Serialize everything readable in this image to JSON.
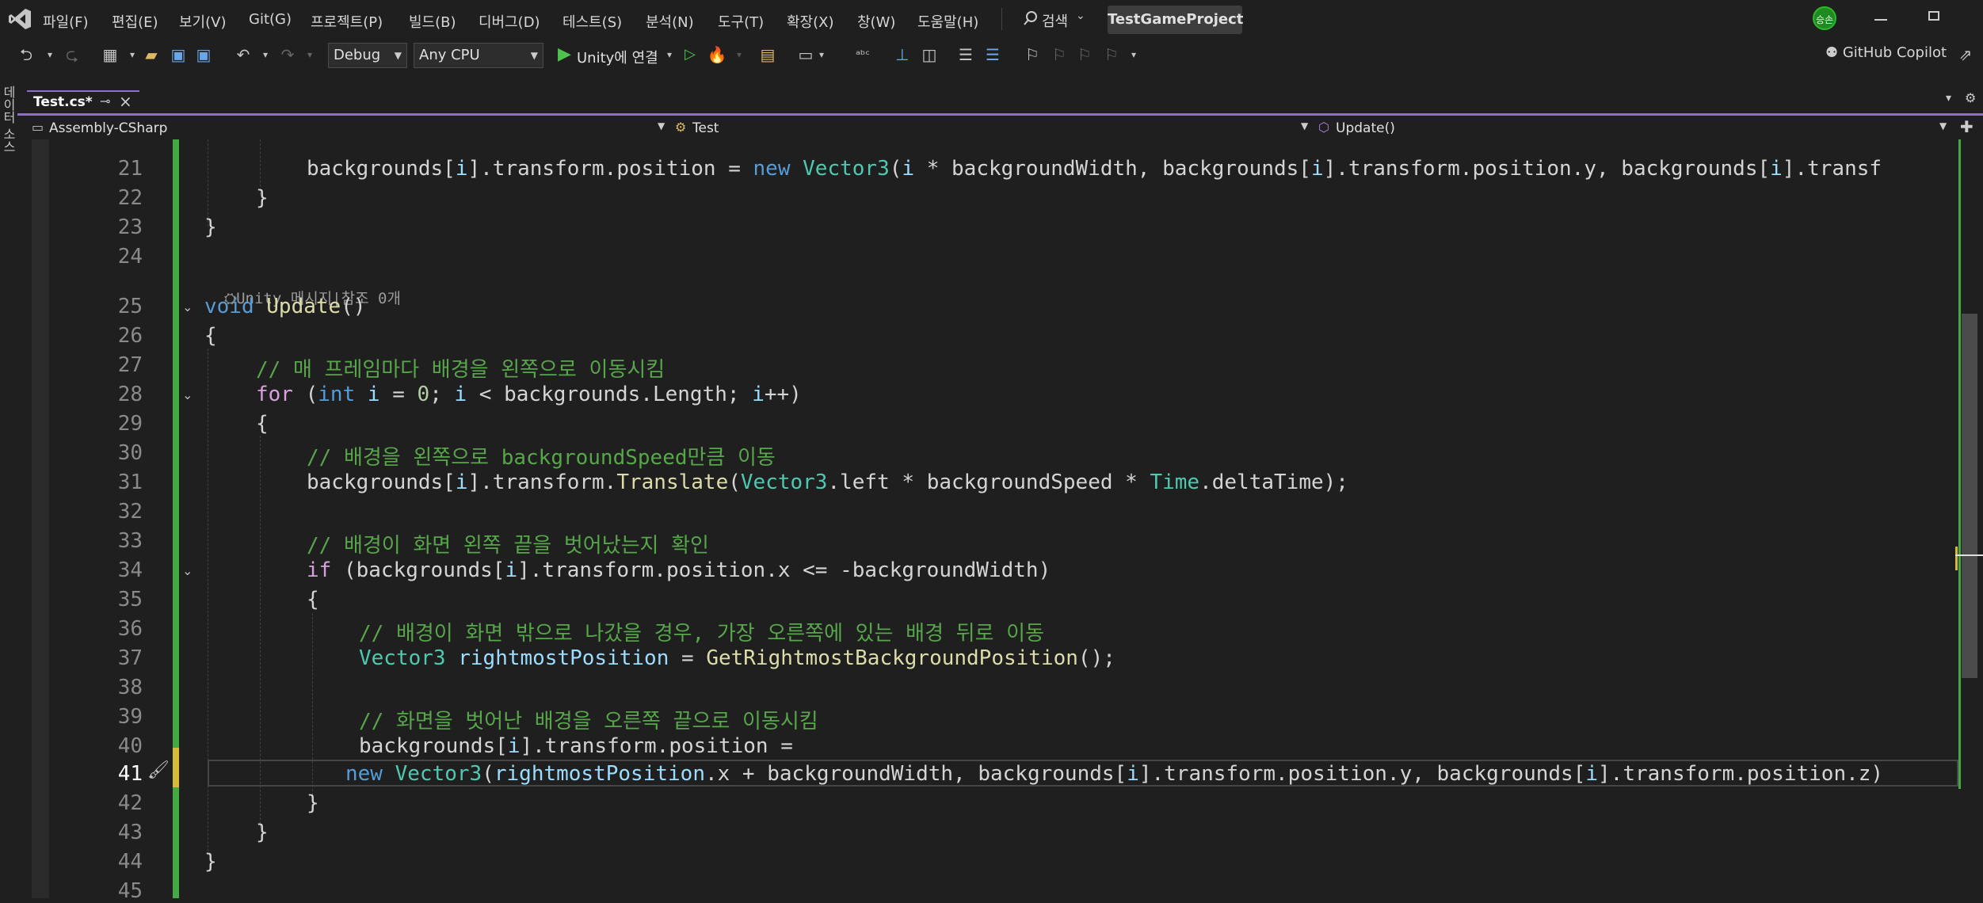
{
  "menu": {
    "items": [
      "파일(F)",
      "편집(E)",
      "보기(V)",
      "Git(G)",
      "프로젝트(P)",
      "빌드(B)",
      "디버그(D)",
      "테스트(S)",
      "분석(N)",
      "도구(T)",
      "확장(X)",
      "창(W)",
      "도움말(H)"
    ],
    "search_label": "검색",
    "project_name": "TestGameProject",
    "avatar_initials": "승손"
  },
  "toolbar": {
    "config": "Debug",
    "platform": "Any CPU",
    "run_label": "Unity에 연결",
    "copilot_label": "GitHub Copilot"
  },
  "left_rail": {
    "label": "데이터 소스"
  },
  "tabs": [
    {
      "label": "Test.cs*"
    }
  ],
  "navbar": {
    "project": "Assembly-CSharp",
    "class": "Test",
    "member": "Update()"
  },
  "editor": {
    "codelens": "Unity 메시지|참조 0개",
    "line_numbers": [
      "21",
      "22",
      "23",
      "24",
      "25",
      "26",
      "27",
      "28",
      "29",
      "30",
      "31",
      "32",
      "33",
      "34",
      "35",
      "36",
      "37",
      "38",
      "39",
      "40",
      "41",
      "42",
      "43",
      "44",
      "45"
    ],
    "current_line": "41",
    "lines": {
      "l21": "backgrounds[i].transform.position = new Vector3(i * backgroundWidth, backgrounds[i].transform.position.y, backgrounds[i].transf",
      "l22": "}",
      "l23": "}",
      "l25": "void Update()",
      "l26": "{",
      "l27": "// 매 프레임마다 배경을 왼쪽으로 이동시킴",
      "l28": "for (int i = 0; i < backgrounds.Length; i++)",
      "l29": "{",
      "l30": "// 배경을 왼쪽으로 backgroundSpeed만큼 이동",
      "l31": "backgrounds[i].transform.Translate(Vector3.left * backgroundSpeed * Time.deltaTime);",
      "l33": "// 배경이 화면 왼쪽 끝을 벗어났는지 확인",
      "l34": "if (backgrounds[i].transform.position.x <= -backgroundWidth)",
      "l35": "{",
      "l36": "// 배경이 화면 밖으로 나갔을 경우, 가장 오른쪽에 있는 배경 뒤로 이동",
      "l37": "Vector3 rightmostPosition = GetRightmostBackgroundPosition();",
      "l39": "// 화면을 벗어난 배경을 오른쪽 끝으로 이동시킴",
      "l40": "backgrounds[i].transform.position =",
      "l41": "new Vector3(rightmostPosition.x + backgroundWidth, backgrounds[i].transform.position.y, backgrounds[i].transform.position.z)",
      "l42": "}",
      "l43": "}",
      "l44": "}"
    }
  },
  "colors": {
    "accent": "#8f6ec8",
    "change_bar": "#45a845",
    "keyword": "#569cd6",
    "control": "#d8a0df",
    "type": "#4ec9b0",
    "method": "#dcdcaa",
    "comment": "#57a64a"
  }
}
